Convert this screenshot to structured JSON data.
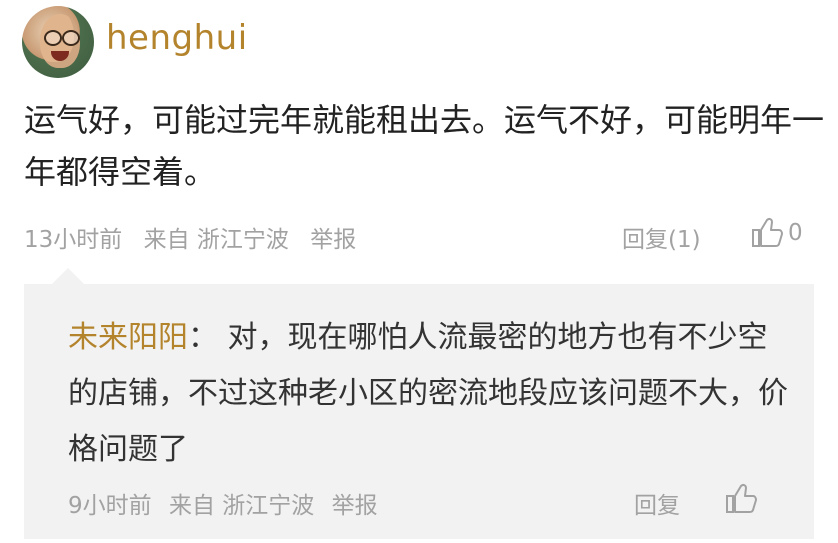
{
  "comment": {
    "username": "henghui",
    "text": "运气好，可能过完年就能租出去。运气不好，可能明年一年都得空着。",
    "time": "13小时前",
    "source": "来自 浙江宁波",
    "report_label": "举报",
    "reply_label": "回复(1)",
    "like_count": "0"
  },
  "reply": {
    "author": "未来阳阳",
    "separator": "：",
    "text": "对，现在哪怕人流最密的地方也有不少空的店铺，不过这种老小区的密流地段应该问题不大，价格问题了",
    "time": "9小时前",
    "source": "来自 浙江宁波",
    "report_label": "举报",
    "reply_label": "回复"
  },
  "colors": {
    "username": "#b4842d",
    "meta": "#a2a2a2",
    "reply_bg": "#f2f2f2"
  },
  "icons": {
    "like": "thumbs-up-icon"
  }
}
